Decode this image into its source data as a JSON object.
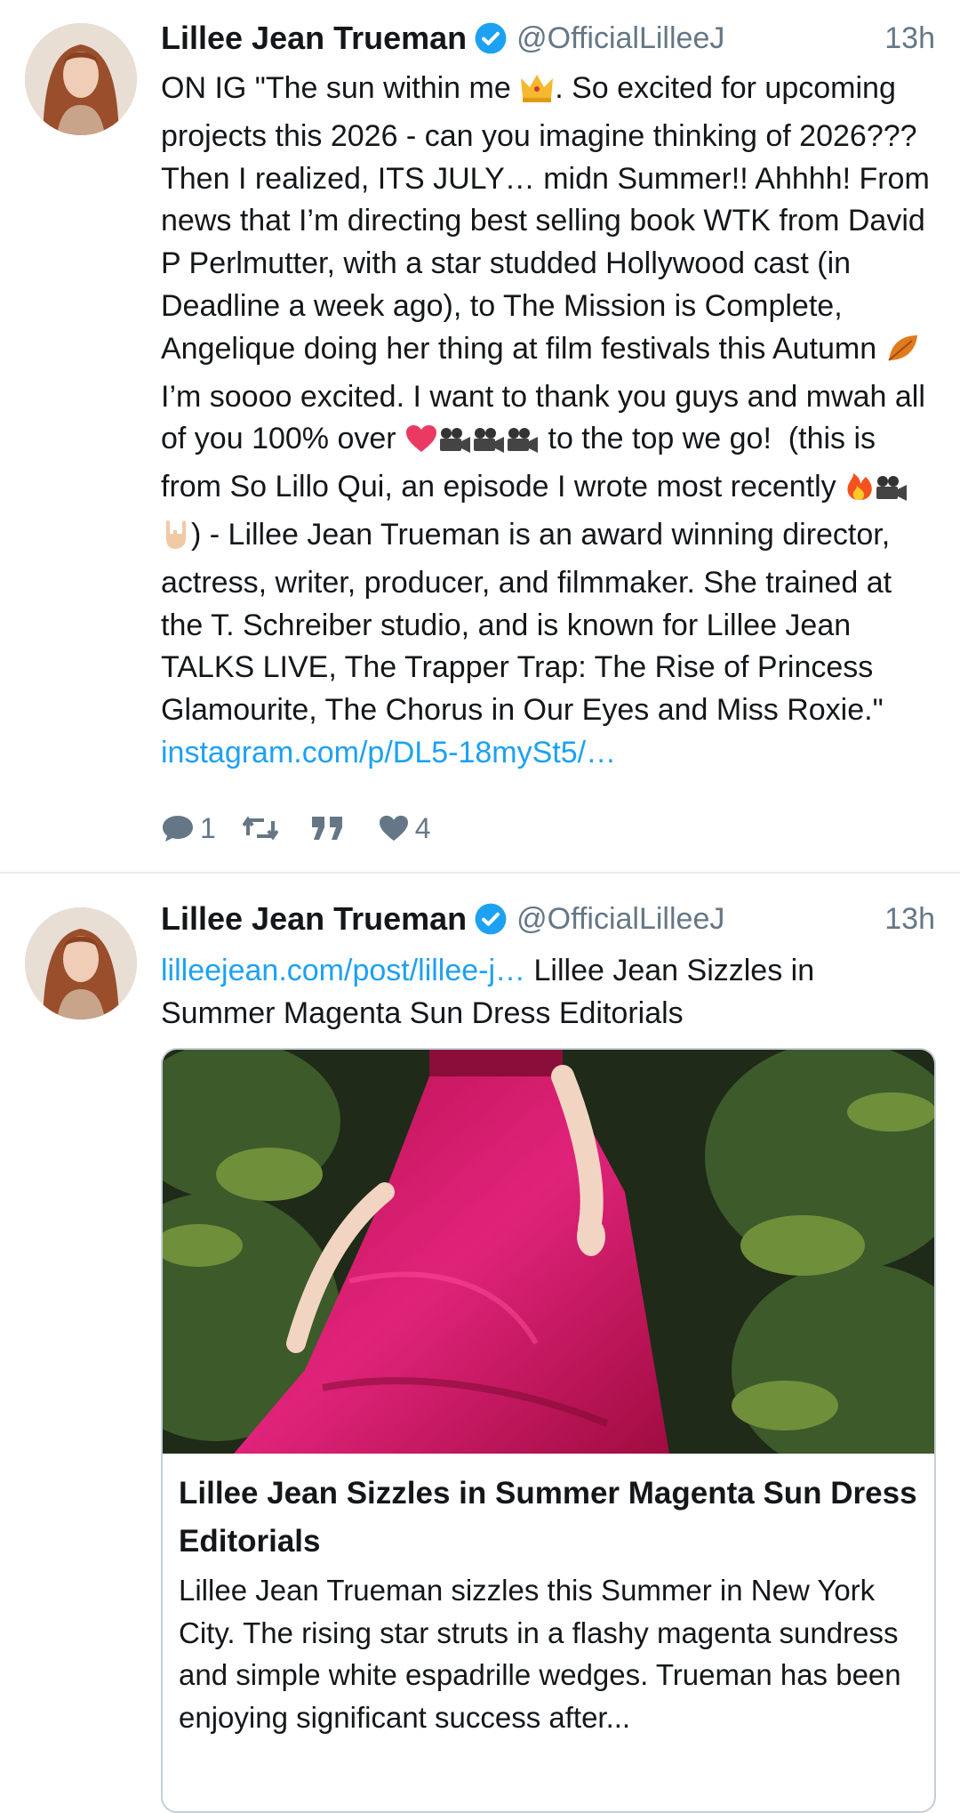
{
  "tweets": [
    {
      "author_name": "Lillee Jean Trueman",
      "handle": "@OfficialLilleeJ",
      "time": "13h",
      "text_parts": {
        "p1": "ON IG \"The sun within me ",
        "p2": ". So excited for upcoming projects this 2026 - can you imagine thinking of 2026??? Then I realized, ITS JULY… midn Summer!! Ahhhh! From news that I’m directing best selling book WTK from David P Perlmutter, with a star studded Hollywood cast (in Deadline a week ago), to The Mission is Complete, Angelique doing her thing at film festivals this Autumn ",
        "p3": " I’m soooo excited. I want to thank you guys and mwah all of you 100% over ",
        "p4": " to the top we go!  (this is from So Lillo Qui, an episode I wrote most recently ",
        "p5": ") - Lillee Jean Trueman is an award winning director, actress, writer, producer, and filmmaker. She trained at the T. Schreiber studio, and is known for Lillee Jean TALKS LIVE, The Trapper Trap: The Rise of Princess Glamourite, The Chorus in Our Eyes and Miss Roxie.\" ",
        "link": "instagram.com/p/DL5-18mySt5/…"
      },
      "emoji_icons": [
        "crown-icon",
        "falling-leaf-icon",
        "heart-icon",
        "movie-camera-icon",
        "fire-icon",
        "rock-on-hand-icon"
      ],
      "actions": {
        "reply_count": "1",
        "retweet_count": "",
        "quote_count": "",
        "like_count": "4"
      }
    },
    {
      "author_name": "Lillee Jean Trueman",
      "handle": "@OfficialLilleeJ",
      "time": "13h",
      "link": "lilleejean.com/post/lillee-j…",
      "text": " Lillee Jean Sizzles in Summer Magenta Sun Dress Editorials",
      "card": {
        "title": "Lillee Jean Sizzles in Summer Magenta Sun Dress Editorials",
        "description": "Lillee Jean Trueman sizzles this Summer in New York City. The rising star struts in a flashy magenta sundress and simple white espadrille wedges. Trueman has been enjoying significant success after..."
      }
    }
  ],
  "colors": {
    "accent": "#1da1f2",
    "muted": "#657786",
    "text": "#14171a",
    "divider": "#e6ecf0",
    "dress": "#d0155f"
  }
}
